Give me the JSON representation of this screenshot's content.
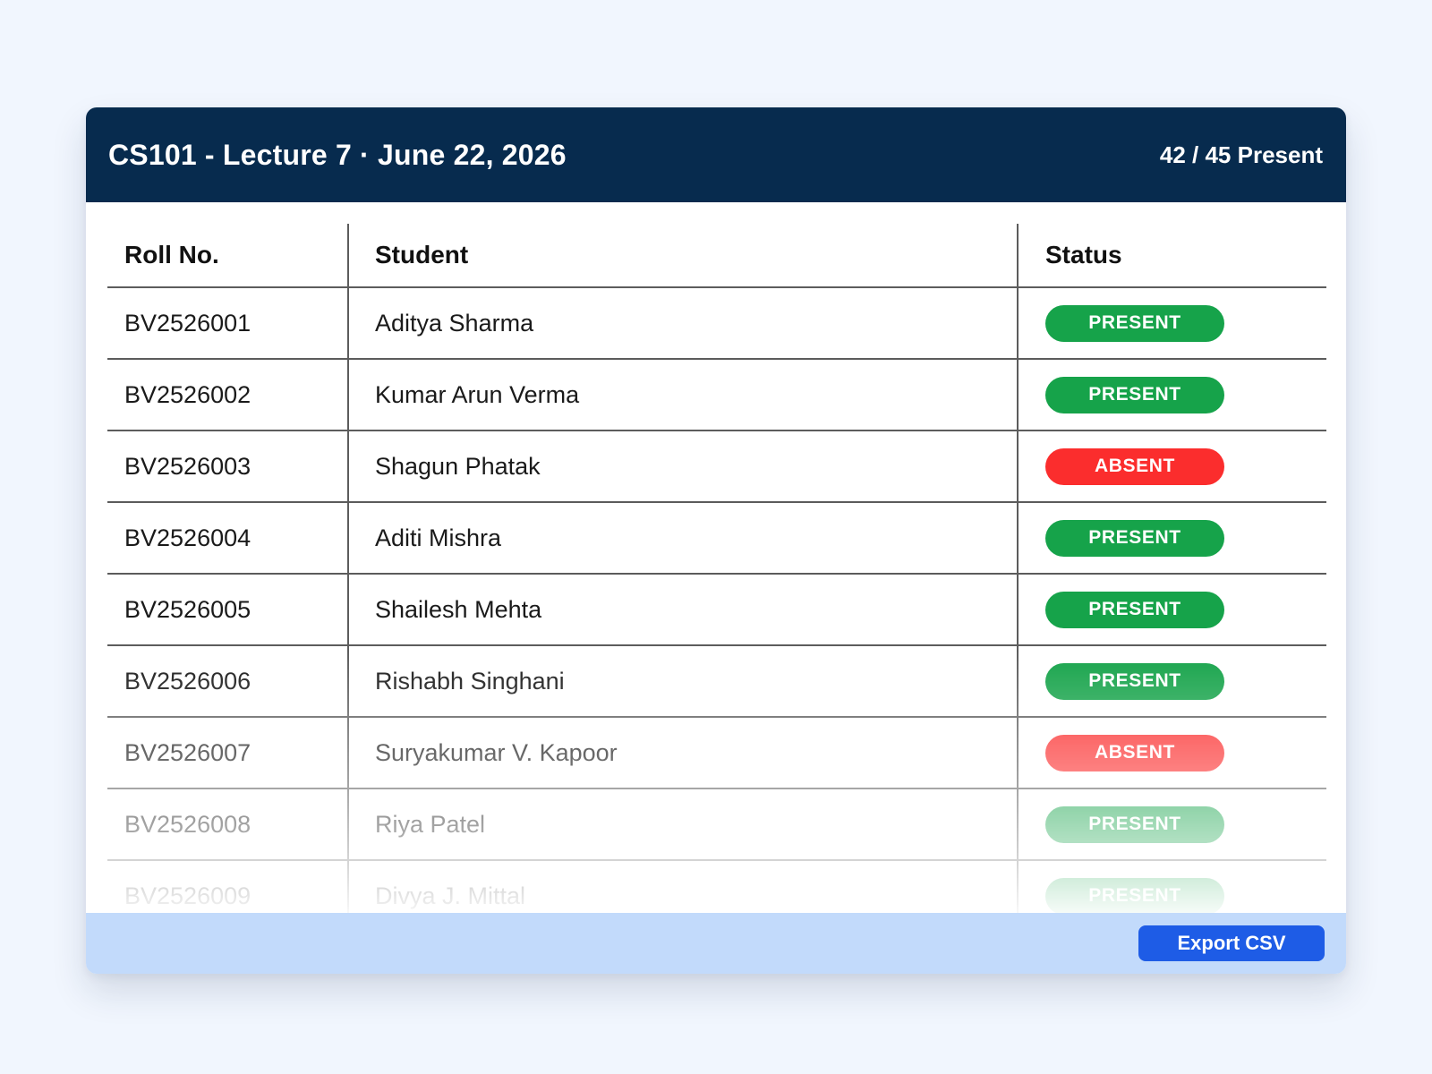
{
  "header": {
    "title": "CS101 - Lecture 7 · June 22, 2026",
    "count": "42 / 45 Present"
  },
  "table": {
    "columns": [
      "Roll No.",
      "Student",
      "Status"
    ],
    "rows": [
      {
        "roll": "BV2526001",
        "name": "Aditya Sharma",
        "status": "PRESENT"
      },
      {
        "roll": "BV2526002",
        "name": "Kumar Arun Verma",
        "status": "PRESENT"
      },
      {
        "roll": "BV2526003",
        "name": "Shagun Phatak",
        "status": "ABSENT"
      },
      {
        "roll": "BV2526004",
        "name": "Aditi Mishra",
        "status": "PRESENT"
      },
      {
        "roll": "BV2526005",
        "name": "Shailesh Mehta",
        "status": "PRESENT"
      },
      {
        "roll": "BV2526006",
        "name": "Rishabh Singhani",
        "status": "PRESENT"
      },
      {
        "roll": "BV2526007",
        "name": "Suryakumar V. Kapoor",
        "status": "ABSENT"
      },
      {
        "roll": "BV2526008",
        "name": "Riya Patel",
        "status": "PRESENT"
      },
      {
        "roll": "BV2526009",
        "name": "Divya J. Mittal",
        "status": "PRESENT"
      }
    ]
  },
  "footer": {
    "export_label": "Export CSV"
  },
  "colors": {
    "header_bg": "#072b4e",
    "present": "#16a34a",
    "absent": "#fb2d2d",
    "footer_bg": "#c2dafb",
    "export_button": "#1e5ce6"
  }
}
